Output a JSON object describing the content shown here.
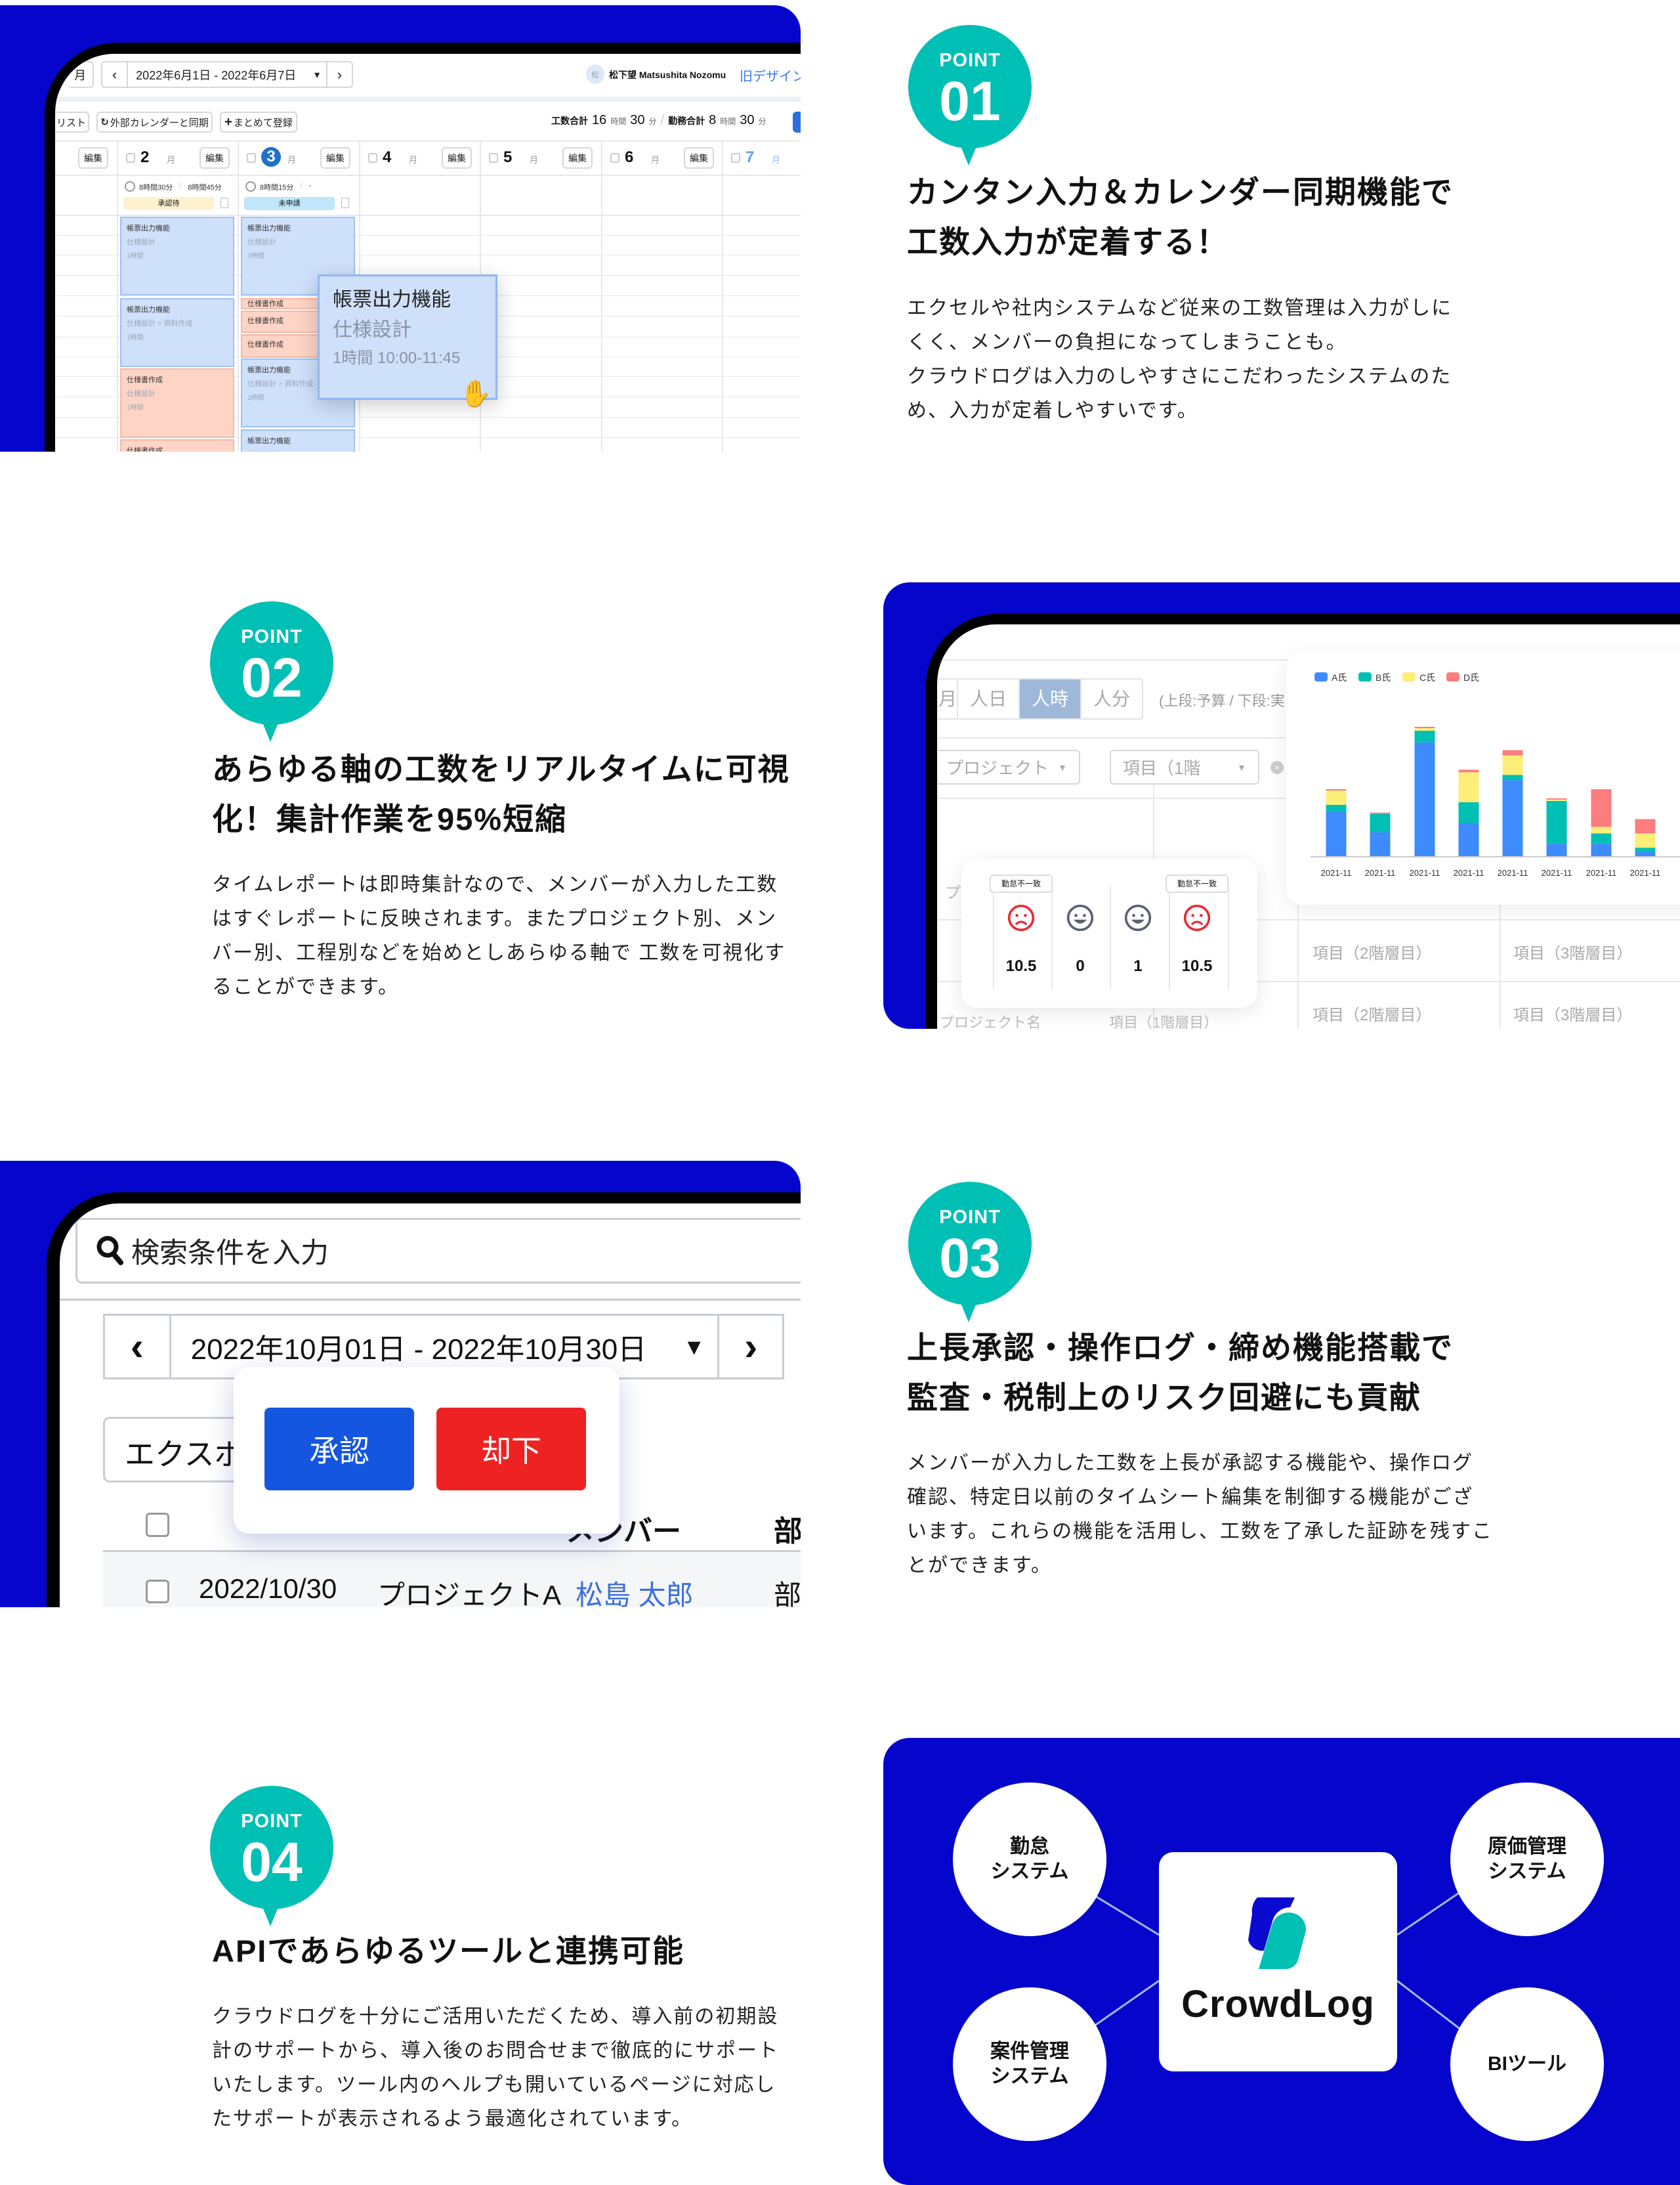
{
  "colors": {
    "brand_blue": "#0505cc",
    "teal": "#00bfb5",
    "approve": "#1556e0",
    "reject": "#ee2222"
  },
  "point1": {
    "label": "POINT",
    "number": "01",
    "title_lines": [
      "カンタン入力＆カレンダー同期機能で",
      "工数入力が定着する！"
    ],
    "body_lines": [
      "エクセルや社内システムなど従来の工数管理は入力がしに",
      "くく、メンバーの負担になってしまうことも。",
      "クラウドログは入力のしやすさにこだわったシステムのた",
      "め、入力が定着しやすいです。"
    ]
  },
  "point2": {
    "label": "POINT",
    "number": "02",
    "title_lines": [
      "あらゆる軸の工数をリアルタイムに可視",
      "化！集計作業を95%短縮"
    ],
    "body_lines": [
      "タイムレポートは即時集計なので、メンバーが入力した工数",
      "はすぐレポートに反映されます。またプロジェクト別、メン",
      "バー別、工程別などを始めとしあらゆる軸で 工数を可視化す",
      "ることができます。"
    ]
  },
  "point3": {
    "label": "POINT",
    "number": "03",
    "title_lines": [
      "上長承認・操作ログ・締め機能搭載で",
      "監査・税制上のリスク回避にも貢献"
    ],
    "body_lines": [
      "メンバーが入力した工数を上長が承認する機能や、操作ログ",
      "確認、特定日以前のタイムシート編集を制御する機能がござ",
      "います。これらの機能を活用し、工数を了承した証跡を残すこ",
      "とができます。"
    ]
  },
  "point4": {
    "label": "POINT",
    "number": "04",
    "title_lines": [
      "APIであらゆるツールと連携可能"
    ],
    "body_lines": [
      "クラウドログを十分にご活用いただくため、導入前の初期設",
      "計のサポートから、導入後のお問合せまで徹底的にサポート",
      "いたします。ツール内のヘルプも開いているページに対応し",
      "たサポートが表示されるよう最適化されています。"
    ]
  },
  "calendar": {
    "view_month": "月",
    "date_range": "2022年6月1日 - 2022年6月7日",
    "prev": "‹",
    "next": "›",
    "caret": "▾",
    "user_avatar": "松",
    "user_name": "松下望 Matsushita Nozomu",
    "old_design_link": "旧デザインに",
    "list_button": "リスト",
    "sync_button": "外部カレンダーと同期",
    "bulk_button": "まとめて登録",
    "totals": {
      "work_label": "工数合計",
      "work_h": "16",
      "h_unit": "時間",
      "work_m": "30",
      "m_unit": "分",
      "sep": "/",
      "attend_label": "勤務合計",
      "attend_h": "8",
      "attend_m": "30"
    },
    "edit_label": "編集",
    "weekday": "月",
    "days": [
      {
        "num": "2"
      },
      {
        "num": "3",
        "today": true
      },
      {
        "num": "4"
      },
      {
        "num": "5"
      },
      {
        "num": "6"
      },
      {
        "num": "7",
        "muted": true
      }
    ],
    "summaries": [
      {
        "work": "8時間30分",
        "sep": "/",
        "attend": "8時間45分",
        "badge": "承認待",
        "badge_color": "#fdf1cf"
      },
      {
        "work": "8時間15分",
        "sep": "/",
        "attend": "-",
        "badge": "未申請",
        "badge_color": "#bfe6fb"
      }
    ],
    "events": [
      {
        "col": 0,
        "kind": "blue",
        "title": "帳票出力機能",
        "task": "仕様設計",
        "dur": "1時間"
      },
      {
        "col": 0,
        "kind": "blue",
        "title": "帳票出力機能",
        "task": "仕様設計 > 資料作成",
        "dur": "1時間"
      },
      {
        "col": 0,
        "kind": "salmon",
        "title": "仕様書作成",
        "task": "仕様設計",
        "dur": "1時間"
      },
      {
        "col": 0,
        "kind": "salmon",
        "title": "仕様書作成",
        "task": "",
        "dur": ""
      },
      {
        "col": 1,
        "kind": "blue",
        "title": "帳票出力機能",
        "task": "仕様設計",
        "dur": "1時間"
      },
      {
        "col": 1,
        "kind": "salmon",
        "title": "仕様書作成",
        "task": "",
        "dur": ""
      },
      {
        "col": 1,
        "kind": "salmon",
        "title": "仕様書作成",
        "task": "",
        "dur": ""
      },
      {
        "col": 1,
        "kind": "salmon",
        "title": "仕様書作成",
        "task": "",
        "dur": ""
      },
      {
        "col": 1,
        "kind": "blue",
        "title": "帳票出力機能",
        "task": "仕様設計 > 資料作成",
        "dur": "1時間"
      },
      {
        "col": 1,
        "kind": "blue",
        "title": "帳票出力機能",
        "task": "仕様設計",
        "dur": ""
      }
    ],
    "popup": {
      "title": "帳票出力機能",
      "task": "仕様設計",
      "time": "1時間  10:00-11:45"
    }
  },
  "report": {
    "units": [
      {
        "label": "人月"
      },
      {
        "label": "人日"
      },
      {
        "label": "人時",
        "active": true
      },
      {
        "label": "人分"
      }
    ],
    "note": "(上段:予算 / 下段:実",
    "filter_project": "プロジェクト",
    "filter_item": "項目（1階",
    "rows": [
      {
        "c1": "プロジェ",
        "c3": "項目（2階層目）",
        "c4": "項目（3階層目）"
      },
      {
        "c1": "プロジェクト名",
        "c2": "項目（1階層目）",
        "c3": "項目（2階層目）",
        "c4": "項目（3階層目）"
      }
    ],
    "attendance": [
      {
        "tag": "勤怠不一致",
        "face": "sad",
        "value": "10.5"
      },
      {
        "tag": "",
        "face": "happy",
        "value": "0"
      },
      {
        "tag": "",
        "face": "happy",
        "value": "1"
      },
      {
        "tag": "勤怠不一致",
        "face": "sad",
        "value": "10.5"
      }
    ]
  },
  "chart_data": {
    "type": "bar",
    "stacked": true,
    "title": "",
    "xlabel": "",
    "ylabel": "",
    "grid": false,
    "legend_position": "top-left",
    "categories": [
      "2021-11",
      "2021-11",
      "2021-11",
      "2021-11",
      "2021-11",
      "2021-11",
      "2021-11",
      "2021-11"
    ],
    "series": [
      {
        "name": "A氏",
        "color": "#3d8bfd",
        "values": [
          35,
          19,
          88,
          26,
          59,
          10,
          10,
          4
        ]
      },
      {
        "name": "B氏",
        "color": "#00bfb3",
        "values": [
          5,
          14,
          9,
          16,
          4,
          33,
          8,
          3
        ]
      },
      {
        "name": "C氏",
        "color": "#fdee78",
        "values": [
          11,
          0,
          2,
          23,
          15,
          1,
          5,
          11
        ]
      },
      {
        "name": "D氏",
        "color": "#fd7c7e",
        "values": [
          1,
          1,
          1,
          2,
          4,
          1,
          29,
          11
        ]
      }
    ]
  },
  "approval": {
    "search_placeholder": "検索条件を入力",
    "prev": "‹",
    "next": "›",
    "date_range": "2022年10月01日 - 2022年10月30日",
    "caret": "▾",
    "export_button": "エクスポート",
    "approve": "承認",
    "reject": "却下",
    "columns": {
      "member": "メンバー",
      "dept": "部署"
    },
    "row": {
      "date": "2022/10/30",
      "project": "プロジェクトA",
      "member": "松島 太郎",
      "dept": "部署"
    }
  },
  "integration": {
    "center_logo": "CrowdLog",
    "nodes": [
      {
        "label_lines": [
          "勤怠",
          "システム"
        ]
      },
      {
        "label_lines": [
          "原価管理",
          "システム"
        ]
      },
      {
        "label_lines": [
          "案件管理",
          "システム"
        ]
      },
      {
        "label_lines": [
          "BIツール"
        ]
      }
    ]
  }
}
